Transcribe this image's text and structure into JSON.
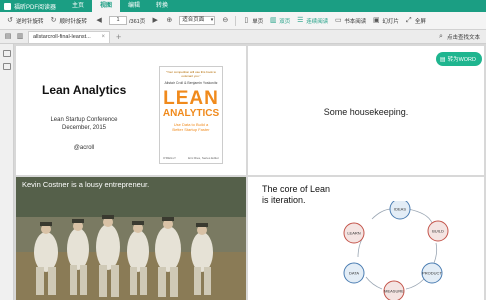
{
  "titlebar": {
    "app_title": "福昕PDF阅读器",
    "tabs": [
      "主页",
      "视图",
      "编辑",
      "转换"
    ],
    "active_tab": 1
  },
  "toolbar": {
    "rotate_left": "逆时针旋转",
    "rotate_right": "顺时针旋转",
    "current_page": "1",
    "page_total": "/361页",
    "zoom": "适合页面",
    "single_page": "单页",
    "double_page": "双页",
    "continuous": "连续阅读",
    "book_mode": "书本阅读",
    "slideshow": "幻灯片",
    "fullscreen": "全屏"
  },
  "docbar": {
    "file_tab": "allstarcroll-final-leanst...",
    "search_label": "点击查找文本"
  },
  "slides": {
    "s1": {
      "title": "Lean Analytics",
      "conference": "Lean Startup Conference",
      "date": "December, 2015",
      "handle": "@acroll"
    },
    "book": {
      "quote": "\"Your competition will use this book to outsmart you.\"",
      "authors": "Alistair Croll & Benjamin Yoskovitz",
      "lean": "LEAN",
      "analytics": "ANALYTICS",
      "tagline_1": "Use Data to Build a",
      "tagline_2": "Better Startup Faster",
      "publisher": "O'REILLY",
      "series": "Eric Ries, Series Editor"
    },
    "s2": {
      "text": "Some housekeeping.",
      "to_word": "转为WORD"
    },
    "s3": {
      "caption": "Kevin Costner is a lousy entrepreneur."
    },
    "s4": {
      "line1": "The core of Lean",
      "line2": "is iteration.",
      "nodes": [
        "IDEAS",
        "BUILD",
        "PRODUCT",
        "MEASURE",
        "DATA",
        "LEARN"
      ]
    }
  },
  "colors": {
    "brand": "#1b9e83",
    "book_orange": "#f08a1c",
    "to_word": "#1fb58f",
    "cycle_node_fill": "#f4e4e2",
    "cycle_node_stroke": "#c4554b",
    "cycle_node_fill_blue": "#e3edf6",
    "cycle_node_stroke_blue": "#4b7db2"
  },
  "icons": {
    "rotate_left": "rotate-ccw-icon",
    "rotate_right": "rotate-cw-icon",
    "prev": "prev-page-icon",
    "next": "next-page-icon",
    "zoom_in": "zoom-in-icon",
    "zoom_out": "zoom-out-icon",
    "single": "single-page-icon",
    "double": "double-page-icon",
    "continuous": "continuous-icon",
    "book": "book-icon",
    "slideshow": "slideshow-icon",
    "fullscreen": "fullscreen-icon",
    "search": "search-icon"
  }
}
